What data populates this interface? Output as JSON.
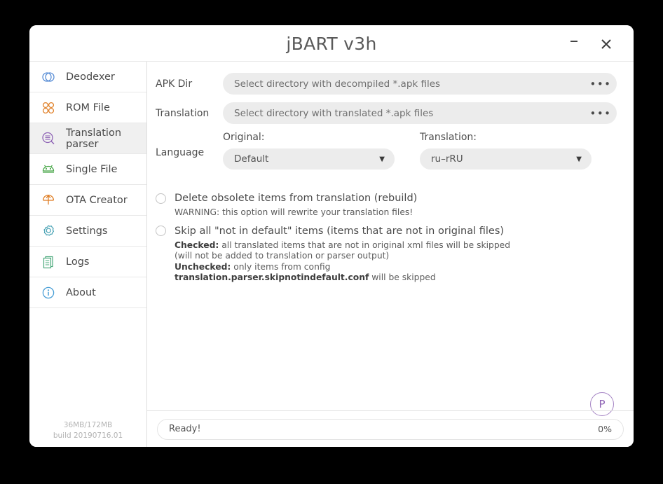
{
  "window": {
    "title": "jBART v3h",
    "minimize_label": "–",
    "close_label": "✕"
  },
  "sidebar": {
    "items": [
      {
        "label": "Deodexer",
        "icon": "linked-circles-icon",
        "color": "#5b8fd6",
        "active": false
      },
      {
        "label": "ROM File",
        "icon": "four-circles-icon",
        "color": "#e08028",
        "active": false
      },
      {
        "label": "Translation parser",
        "icon": "search-list-icon",
        "color": "#8e63b5",
        "active": true
      },
      {
        "label": "Single File",
        "icon": "android-icon",
        "color": "#4aa84a",
        "active": false
      },
      {
        "label": "OTA Creator",
        "icon": "upload-arrow-icon",
        "color": "#e08028",
        "active": false
      },
      {
        "label": "Settings",
        "icon": "gear-icon",
        "color": "#4aa3b5",
        "active": false
      },
      {
        "label": "Logs",
        "icon": "documents-icon",
        "color": "#4aa87a",
        "active": false
      },
      {
        "label": "About",
        "icon": "info-icon",
        "color": "#4a9fd6",
        "active": false
      }
    ],
    "footer": {
      "memory": "36MB/172MB",
      "build": "build 20190716.01"
    }
  },
  "main": {
    "apk_dir": {
      "label": "APK Dir",
      "placeholder": "Select directory with decompiled *.apk files",
      "value": "",
      "browse_label": "•••"
    },
    "translation_dir": {
      "label": "Translation",
      "placeholder": "Select directory with translated *.apk files",
      "value": "",
      "browse_label": "•••"
    },
    "language": {
      "label": "Language",
      "original": {
        "caption": "Original:",
        "selected": "Default",
        "caret": "▼"
      },
      "translation": {
        "caption": "Translation:",
        "selected": "ru–rRU",
        "caret": "▼"
      }
    },
    "options": [
      {
        "title": "Delete obsolete items from translation (rebuild)",
        "checked": false,
        "description_parts": [
          {
            "text": "WARNING: this option will rewrite your translation files!",
            "bold": false
          }
        ]
      },
      {
        "title": "Skip all \"not in default\" items (items that are not in original files)",
        "checked": false,
        "description_parts": [
          {
            "text": "Checked:",
            "bold": true
          },
          {
            "text": " all translated items that are not in original xml files will be skipped (will not be added to translation or parser output)",
            "bold": false
          },
          {
            "text": "\n",
            "bold": false
          },
          {
            "text": "Unchecked:",
            "bold": true
          },
          {
            "text": " only items from config ",
            "bold": false
          },
          {
            "text": "translation.parser.skipnotindefault.conf",
            "bold": true
          },
          {
            "text": " will be skipped",
            "bold": false
          }
        ]
      }
    ],
    "profile_badge": "P"
  },
  "statusbar": {
    "status": "Ready!",
    "percent": "0%"
  },
  "colors": {
    "accent_purple": "#8e63b5",
    "field_bg": "#ececec",
    "window_bg": "#ffffff",
    "desktop_bg": "#000000"
  }
}
